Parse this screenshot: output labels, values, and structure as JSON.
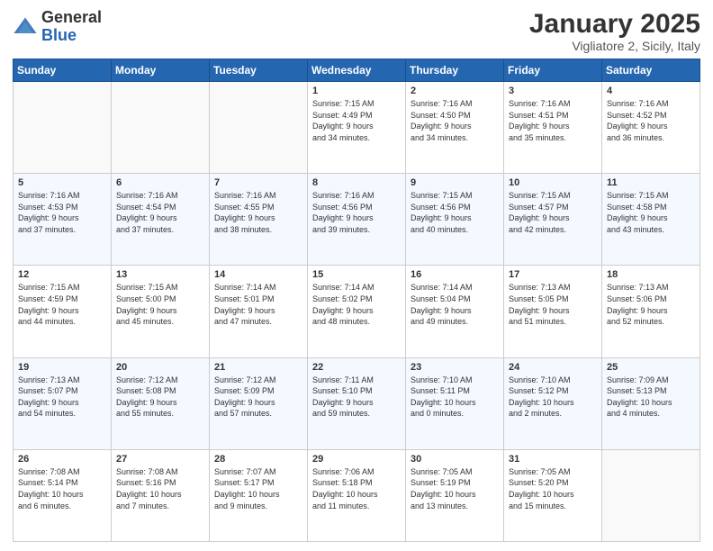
{
  "header": {
    "logo_general": "General",
    "logo_blue": "Blue",
    "month_title": "January 2025",
    "location": "Vigliatore 2, Sicily, Italy"
  },
  "weekdays": [
    "Sunday",
    "Monday",
    "Tuesday",
    "Wednesday",
    "Thursday",
    "Friday",
    "Saturday"
  ],
  "weeks": [
    [
      {
        "day": "",
        "info": ""
      },
      {
        "day": "",
        "info": ""
      },
      {
        "day": "",
        "info": ""
      },
      {
        "day": "1",
        "info": "Sunrise: 7:15 AM\nSunset: 4:49 PM\nDaylight: 9 hours\nand 34 minutes."
      },
      {
        "day": "2",
        "info": "Sunrise: 7:16 AM\nSunset: 4:50 PM\nDaylight: 9 hours\nand 34 minutes."
      },
      {
        "day": "3",
        "info": "Sunrise: 7:16 AM\nSunset: 4:51 PM\nDaylight: 9 hours\nand 35 minutes."
      },
      {
        "day": "4",
        "info": "Sunrise: 7:16 AM\nSunset: 4:52 PM\nDaylight: 9 hours\nand 36 minutes."
      }
    ],
    [
      {
        "day": "5",
        "info": "Sunrise: 7:16 AM\nSunset: 4:53 PM\nDaylight: 9 hours\nand 37 minutes."
      },
      {
        "day": "6",
        "info": "Sunrise: 7:16 AM\nSunset: 4:54 PM\nDaylight: 9 hours\nand 37 minutes."
      },
      {
        "day": "7",
        "info": "Sunrise: 7:16 AM\nSunset: 4:55 PM\nDaylight: 9 hours\nand 38 minutes."
      },
      {
        "day": "8",
        "info": "Sunrise: 7:16 AM\nSunset: 4:56 PM\nDaylight: 9 hours\nand 39 minutes."
      },
      {
        "day": "9",
        "info": "Sunrise: 7:15 AM\nSunset: 4:56 PM\nDaylight: 9 hours\nand 40 minutes."
      },
      {
        "day": "10",
        "info": "Sunrise: 7:15 AM\nSunset: 4:57 PM\nDaylight: 9 hours\nand 42 minutes."
      },
      {
        "day": "11",
        "info": "Sunrise: 7:15 AM\nSunset: 4:58 PM\nDaylight: 9 hours\nand 43 minutes."
      }
    ],
    [
      {
        "day": "12",
        "info": "Sunrise: 7:15 AM\nSunset: 4:59 PM\nDaylight: 9 hours\nand 44 minutes."
      },
      {
        "day": "13",
        "info": "Sunrise: 7:15 AM\nSunset: 5:00 PM\nDaylight: 9 hours\nand 45 minutes."
      },
      {
        "day": "14",
        "info": "Sunrise: 7:14 AM\nSunset: 5:01 PM\nDaylight: 9 hours\nand 47 minutes."
      },
      {
        "day": "15",
        "info": "Sunrise: 7:14 AM\nSunset: 5:02 PM\nDaylight: 9 hours\nand 48 minutes."
      },
      {
        "day": "16",
        "info": "Sunrise: 7:14 AM\nSunset: 5:04 PM\nDaylight: 9 hours\nand 49 minutes."
      },
      {
        "day": "17",
        "info": "Sunrise: 7:13 AM\nSunset: 5:05 PM\nDaylight: 9 hours\nand 51 minutes."
      },
      {
        "day": "18",
        "info": "Sunrise: 7:13 AM\nSunset: 5:06 PM\nDaylight: 9 hours\nand 52 minutes."
      }
    ],
    [
      {
        "day": "19",
        "info": "Sunrise: 7:13 AM\nSunset: 5:07 PM\nDaylight: 9 hours\nand 54 minutes."
      },
      {
        "day": "20",
        "info": "Sunrise: 7:12 AM\nSunset: 5:08 PM\nDaylight: 9 hours\nand 55 minutes."
      },
      {
        "day": "21",
        "info": "Sunrise: 7:12 AM\nSunset: 5:09 PM\nDaylight: 9 hours\nand 57 minutes."
      },
      {
        "day": "22",
        "info": "Sunrise: 7:11 AM\nSunset: 5:10 PM\nDaylight: 9 hours\nand 59 minutes."
      },
      {
        "day": "23",
        "info": "Sunrise: 7:10 AM\nSunset: 5:11 PM\nDaylight: 10 hours\nand 0 minutes."
      },
      {
        "day": "24",
        "info": "Sunrise: 7:10 AM\nSunset: 5:12 PM\nDaylight: 10 hours\nand 2 minutes."
      },
      {
        "day": "25",
        "info": "Sunrise: 7:09 AM\nSunset: 5:13 PM\nDaylight: 10 hours\nand 4 minutes."
      }
    ],
    [
      {
        "day": "26",
        "info": "Sunrise: 7:08 AM\nSunset: 5:14 PM\nDaylight: 10 hours\nand 6 minutes."
      },
      {
        "day": "27",
        "info": "Sunrise: 7:08 AM\nSunset: 5:16 PM\nDaylight: 10 hours\nand 7 minutes."
      },
      {
        "day": "28",
        "info": "Sunrise: 7:07 AM\nSunset: 5:17 PM\nDaylight: 10 hours\nand 9 minutes."
      },
      {
        "day": "29",
        "info": "Sunrise: 7:06 AM\nSunset: 5:18 PM\nDaylight: 10 hours\nand 11 minutes."
      },
      {
        "day": "30",
        "info": "Sunrise: 7:05 AM\nSunset: 5:19 PM\nDaylight: 10 hours\nand 13 minutes."
      },
      {
        "day": "31",
        "info": "Sunrise: 7:05 AM\nSunset: 5:20 PM\nDaylight: 10 hours\nand 15 minutes."
      },
      {
        "day": "",
        "info": ""
      }
    ]
  ]
}
